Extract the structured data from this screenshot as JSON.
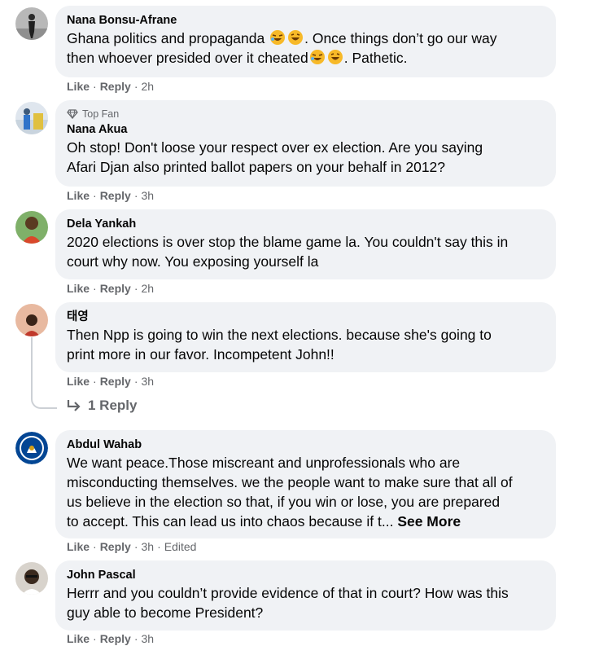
{
  "comments": [
    {
      "author": "Nana Bonsu-Afrane",
      "text1": "Ghana politics and propaganda ",
      "text2": ". Once things don’t go our way",
      "text3": "then whoever presided over it cheated",
      "text4": ". Pathetic.",
      "like": "Like",
      "reply": "Reply",
      "time": "2h",
      "emoji1": "rofl-emoji",
      "emoji2": "grin-emoji"
    },
    {
      "badge": "Top Fan",
      "author": "Nana Akua",
      "line1": "Oh stop! Don't loose your respect over ex election. Are you saying",
      "line2": "Afari Djan also printed ballot papers on your behalf in 2012?",
      "like": "Like",
      "reply": "Reply",
      "time": "3h"
    },
    {
      "author": "Dela Yankah",
      "line1": "2020 elections is over stop the blame game la. You couldn't say this in",
      "line2": "court why now. You exposing yourself la",
      "like": "Like",
      "reply": "Reply",
      "time": "2h"
    },
    {
      "author": "태영",
      "line1": "Then Npp is going to win the next elections. because she's going to",
      "line2": "print more in our favor. Incompetent John!!",
      "like": "Like",
      "reply": "Reply",
      "time": "3h",
      "replies": "1 Reply"
    },
    {
      "author": "Abdul Wahab",
      "line1": "We want peace.Those miscreant and unprofessionals who are",
      "line2": "misconducting themselves. we the people want to make sure that all of",
      "line3": "us believe in the election so that, if you win or lose, you are prepared",
      "line4": "to accept. This can lead us into chaos because if t... ",
      "see_more": "See More",
      "like": "Like",
      "reply": "Reply",
      "time": "3h",
      "edited": "Edited"
    },
    {
      "author": "John Pascal",
      "line1": "Herrr and you couldn’t provide evidence of that in court? How was this",
      "line2": "guy able to become President?",
      "like": "Like",
      "reply": "Reply",
      "time": "3h"
    }
  ],
  "colors": {
    "bubble": "#f0f2f5",
    "meta": "#65676b",
    "text": "#050505",
    "emoji_face": "#f7b928"
  }
}
